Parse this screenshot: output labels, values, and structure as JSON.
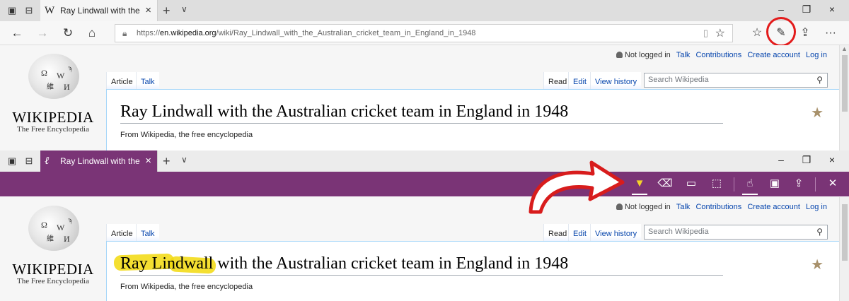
{
  "top": {
    "tab": {
      "favicon": "W",
      "title": "Ray Lindwall with the Au",
      "close": "×"
    },
    "window_controls": {
      "minimize": "–",
      "maximize": "❐",
      "close": "×"
    },
    "new_tab": "+",
    "tab_dropdown": "∨",
    "nav": {
      "back": "←",
      "forward": "→",
      "refresh": "↻",
      "home": "⌂"
    },
    "url": {
      "prefix": "https://",
      "domain": "en.wikipedia.org",
      "path": "/wiki/Ray_Lindwall_with_the_Australian_cricket_team_in_England_in_1948"
    },
    "toolbar_icons": [
      "reading-view-icon",
      "favorites-star-icon",
      "favorites-hub-icon",
      "web-note-pen-icon",
      "share-icon",
      "more-icon"
    ],
    "more_label": "···"
  },
  "bottom": {
    "tab": {
      "favicon": "ℓ",
      "title": "Ray Lindwall with the Au",
      "close": "×"
    },
    "window_controls": {
      "minimize": "–",
      "maximize": "❐",
      "close": "×"
    },
    "new_tab": "+",
    "tab_dropdown": "∨",
    "ink_tools": [
      "pen-icon",
      "highlighter-icon",
      "eraser-icon",
      "comment-icon",
      "clip-icon",
      "touch-write-icon",
      "save-icon",
      "share-icon",
      "exit-icon"
    ]
  },
  "wiki": {
    "wordmark": "WIKIPEDIA",
    "tagline": "The Free Encyclopedia",
    "user": {
      "not_logged_in": "Not logged in",
      "links": [
        "Talk",
        "Contributions",
        "Create account",
        "Log in"
      ]
    },
    "left_tabs": [
      "Article",
      "Talk"
    ],
    "right_tabs": [
      "Read",
      "Edit",
      "View history"
    ],
    "search_placeholder": "Search Wikipedia",
    "title": "Ray Lindwall with the Australian cricket team in England in 1948",
    "subtitle": "From Wikipedia, the free encyclopedia",
    "featured_star": "★"
  },
  "highlighted_text": "Ray Lindwall",
  "colors": {
    "ink_toolbar": "#7a3476",
    "highlighter": "#f2d90d",
    "callout": "#e31b1b",
    "link": "#0645ad"
  }
}
